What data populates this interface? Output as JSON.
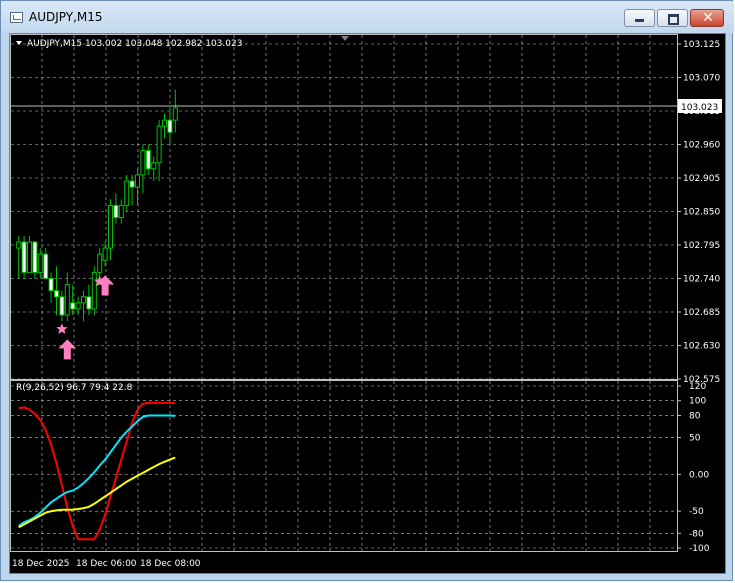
{
  "window": {
    "title": "AUDJPY,M15"
  },
  "colors": {
    "background": "#000000",
    "grid": "#c0c0c0",
    "candle": "#00c000",
    "bull_body": "#000000",
    "bear_body": "#ffffff",
    "arrow": "#ff80c0",
    "rvi_red": "#ff0000",
    "rvi_cyan": "#00e6ff",
    "rvi_yellow": "#ffff00",
    "text": "#ffffff"
  },
  "icons": {
    "window_icon": "chart-window-icon",
    "minimize": "minimize-icon",
    "maximize": "maximize-icon",
    "close": "close-icon",
    "dropdown": "triangle-down-icon"
  },
  "chart_data": [
    {
      "type": "candlestick",
      "header": "AUDJPY,M15  103.002 103.048 102.982 103.023",
      "current_price": "103.023",
      "y_ticks": [
        "103.125",
        "103.070",
        "103.015",
        "102.960",
        "102.905",
        "102.850",
        "102.795",
        "102.740",
        "102.685",
        "102.630",
        "102.575"
      ],
      "ylim": [
        102.575,
        103.125
      ],
      "x_ticks": [
        "18 Dec 2025",
        "18 Dec 06:00",
        "18 Dec 08:00"
      ],
      "grid": true,
      "candles": [
        {
          "o": 102.79,
          "h": 102.81,
          "l": 102.74,
          "c": 102.8
        },
        {
          "o": 102.8,
          "h": 102.81,
          "l": 102.74,
          "c": 102.75
        },
        {
          "o": 102.75,
          "h": 102.81,
          "l": 102.75,
          "c": 102.8
        },
        {
          "o": 102.8,
          "h": 102.8,
          "l": 102.74,
          "c": 102.75
        },
        {
          "o": 102.75,
          "h": 102.79,
          "l": 102.74,
          "c": 102.78
        },
        {
          "o": 102.78,
          "h": 102.79,
          "l": 102.74,
          "c": 102.74
        },
        {
          "o": 102.74,
          "h": 102.75,
          "l": 102.7,
          "c": 102.72
        },
        {
          "o": 102.72,
          "h": 102.76,
          "l": 102.68,
          "c": 102.71
        },
        {
          "o": 102.71,
          "h": 102.72,
          "l": 102.67,
          "c": 102.68
        },
        {
          "o": 102.68,
          "h": 102.75,
          "l": 102.67,
          "c": 102.73
        },
        {
          "o": 102.7,
          "h": 102.73,
          "l": 102.68,
          "c": 102.69
        },
        {
          "o": 102.69,
          "h": 102.71,
          "l": 102.68,
          "c": 102.7
        },
        {
          "o": 102.7,
          "h": 102.72,
          "l": 102.67,
          "c": 102.71
        },
        {
          "o": 102.71,
          "h": 102.73,
          "l": 102.68,
          "c": 102.69
        },
        {
          "o": 102.69,
          "h": 102.76,
          "l": 102.68,
          "c": 102.75
        },
        {
          "o": 102.75,
          "h": 102.79,
          "l": 102.73,
          "c": 102.78
        },
        {
          "o": 102.77,
          "h": 102.8,
          "l": 102.76,
          "c": 102.79
        },
        {
          "o": 102.79,
          "h": 102.87,
          "l": 102.77,
          "c": 102.86
        },
        {
          "o": 102.86,
          "h": 102.88,
          "l": 102.83,
          "c": 102.84
        },
        {
          "o": 102.84,
          "h": 102.87,
          "l": 102.83,
          "c": 102.86
        },
        {
          "o": 102.86,
          "h": 102.91,
          "l": 102.85,
          "c": 102.9
        },
        {
          "o": 102.9,
          "h": 102.91,
          "l": 102.86,
          "c": 102.89
        },
        {
          "o": 102.89,
          "h": 102.92,
          "l": 102.86,
          "c": 102.91
        },
        {
          "o": 102.91,
          "h": 102.96,
          "l": 102.88,
          "c": 102.95
        },
        {
          "o": 102.95,
          "h": 102.96,
          "l": 102.91,
          "c": 102.92
        },
        {
          "o": 102.92,
          "h": 102.94,
          "l": 102.9,
          "c": 102.93
        },
        {
          "o": 102.93,
          "h": 103.0,
          "l": 102.9,
          "c": 102.99
        },
        {
          "o": 102.99,
          "h": 103.01,
          "l": 102.97,
          "c": 103.0
        },
        {
          "o": 103.0,
          "h": 103.02,
          "l": 102.96,
          "c": 102.98
        },
        {
          "o": 103.0,
          "h": 103.05,
          "l": 102.98,
          "c": 103.02
        }
      ],
      "signals": [
        {
          "type": "star",
          "bar": 8,
          "price": 102.657
        },
        {
          "type": "arrow_up",
          "bar": 9,
          "price": 102.64
        },
        {
          "type": "star",
          "bar": 15,
          "price": 102.735
        },
        {
          "type": "arrow_up",
          "bar": 16,
          "price": 102.745
        }
      ]
    },
    {
      "type": "line",
      "label": "R(9,26,52) 96.7 79.4 22.8",
      "ylim": [
        -100,
        120
      ],
      "y_ticks": [
        "120",
        "100",
        "80",
        "50",
        "0.00",
        "-50",
        "-80",
        "-100"
      ],
      "grid": true,
      "series": [
        {
          "color": "#ff0000",
          "values": [
            90,
            91,
            88,
            82,
            74,
            60,
            40,
            15,
            -15,
            -45,
            -70,
            -88,
            -88,
            -88,
            -88,
            -75,
            -55,
            -30,
            -5,
            20,
            45,
            70,
            88,
            96,
            97,
            97,
            97,
            97,
            97,
            96.7
          ]
        },
        {
          "color": "#00e6ff",
          "values": [
            -70,
            -65,
            -62,
            -58,
            -52,
            -45,
            -38,
            -33,
            -28,
            -24,
            -22,
            -18,
            -12,
            -5,
            3,
            12,
            20,
            30,
            40,
            50,
            58,
            65,
            72,
            78,
            80,
            80,
            80,
            80,
            80,
            79.4
          ]
        },
        {
          "color": "#ffff00",
          "values": [
            -72,
            -68,
            -64,
            -60,
            -56,
            -52,
            -50,
            -49,
            -48,
            -48,
            -48,
            -47,
            -46,
            -44,
            -40,
            -35,
            -30,
            -25,
            -20,
            -15,
            -10,
            -6,
            -2,
            2,
            6,
            10,
            14,
            17,
            20,
            22.8
          ]
        }
      ]
    }
  ]
}
